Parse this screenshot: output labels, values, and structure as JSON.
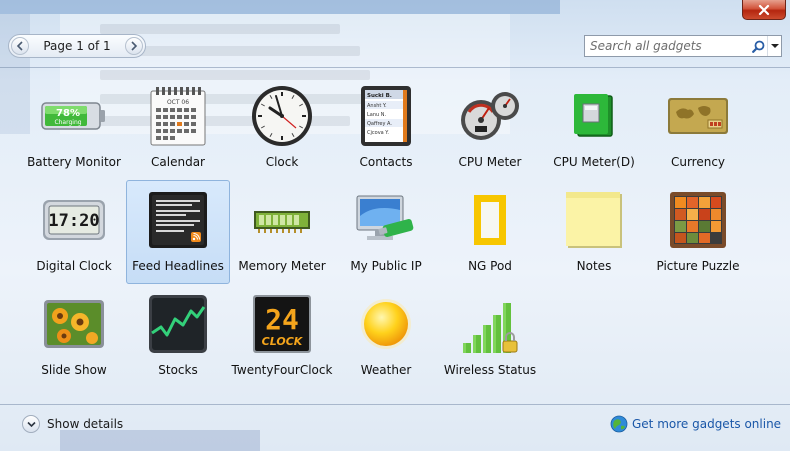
{
  "window": {
    "close_icon": "close-x-icon"
  },
  "toolbar": {
    "page_label": "Page 1 of 1",
    "search_placeholder": "Search all gadgets"
  },
  "gadgets": [
    {
      "label": "Battery Monitor",
      "icon": "battery-icon",
      "selected": false
    },
    {
      "label": "Calendar",
      "icon": "calendar-icon",
      "selected": false
    },
    {
      "label": "Clock",
      "icon": "clock-icon",
      "selected": false
    },
    {
      "label": "Contacts",
      "icon": "contacts-icon",
      "selected": false
    },
    {
      "label": "CPU Meter",
      "icon": "cpu-meter-icon",
      "selected": false
    },
    {
      "label": "CPU Meter(D)",
      "icon": "cpu-chip-icon",
      "selected": false
    },
    {
      "label": "Currency",
      "icon": "currency-icon",
      "selected": false
    },
    {
      "label": "Digital Clock",
      "icon": "digital-clock-icon",
      "selected": false
    },
    {
      "label": "Feed Headlines",
      "icon": "feed-headlines-icon",
      "selected": true
    },
    {
      "label": "Memory Meter",
      "icon": "memory-meter-icon",
      "selected": false
    },
    {
      "label": "My Public IP",
      "icon": "public-ip-icon",
      "selected": false
    },
    {
      "label": "NG Pod",
      "icon": "ng-pod-icon",
      "selected": false
    },
    {
      "label": "Notes",
      "icon": "notes-icon",
      "selected": false
    },
    {
      "label": "Picture Puzzle",
      "icon": "picture-puzzle-icon",
      "selected": false
    },
    {
      "label": "Slide Show",
      "icon": "slide-show-icon",
      "selected": false
    },
    {
      "label": "Stocks",
      "icon": "stocks-icon",
      "selected": false
    },
    {
      "label": "TwentyFourClock",
      "icon": "twentyfour-clock-icon",
      "selected": false
    },
    {
      "label": "Weather",
      "icon": "weather-icon",
      "selected": false
    },
    {
      "label": "Wireless Status",
      "icon": "wireless-status-icon",
      "selected": false
    }
  ],
  "icon_text": {
    "battery_percent": "78%",
    "battery_status": "Charging",
    "calendar_month": "OCT 06",
    "digital_time": "17:20",
    "twentyfour_number": "24",
    "twentyfour_word": "CLOCK",
    "contacts_header": "Sucki B.",
    "contacts_list": [
      "Ansht Y.",
      "Lanu N.",
      "Qaffrey A.",
      "Cjcova Y."
    ]
  },
  "footer": {
    "details_label": "Show details",
    "more_label": "Get more gadgets online"
  },
  "colors": {
    "accent_link": "#1a57a8",
    "selection": "#c4dcf6"
  }
}
